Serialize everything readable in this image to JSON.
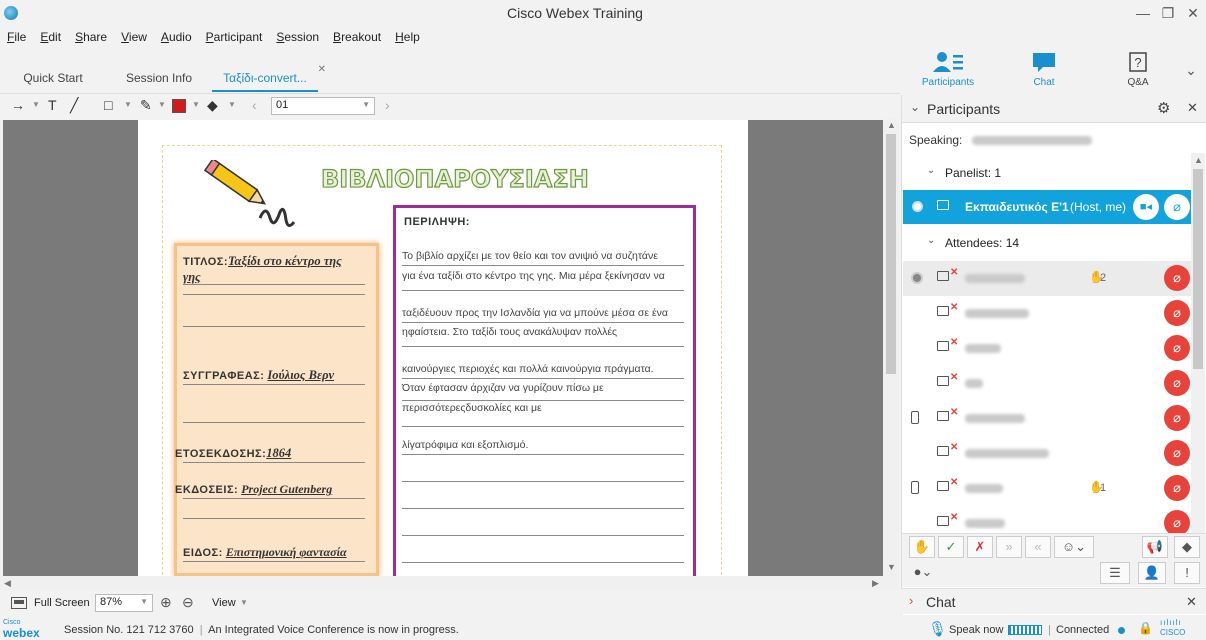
{
  "window": {
    "title": "Cisco Webex Training"
  },
  "menu": [
    "File",
    "Edit",
    "Share",
    "View",
    "Audio",
    "Participant",
    "Session",
    "Breakout",
    "Help"
  ],
  "tabs": [
    {
      "label": "Quick Start",
      "active": false
    },
    {
      "label": "Session Info",
      "active": false
    },
    {
      "label": "Ταξίδι-convert...",
      "active": true
    }
  ],
  "panel_buttons": {
    "participants": "Participants",
    "chat": "Chat",
    "qa": "Q&A"
  },
  "toolbar": {
    "page": "01"
  },
  "document": {
    "title": "ΒΙΒΛΙΟΠΑΡΟΥΣΙΑΣΗ",
    "fields": {
      "title_label": "ΤΙΤΛΟΣ:",
      "title_value": "Ταξίδι στο κέντρο της",
      "title_value2": "γης",
      "author_label": "ΣΥΓΓΡΑΦΕΑΣ:",
      "author_value": "Ιούλιος Βερν",
      "year_label": "ΕΤΟΣΕΚΔΟΣΗΣ:",
      "year_value": "1864",
      "publisher_label": "ΕΚΔΟΣΕΙΣ:",
      "publisher_value": "Project Gutenberg",
      "genre_label": "ΕΙΔΟΣ:",
      "genre_value": "Επιστημονική φαντασία"
    },
    "summary_heading": "ΠΕΡΙΛΗΨΗ:",
    "summary_lines": [
      "Το βιβλίο αρχίζει με τον θείο και τον ανιψιό να συζητάνε",
      "για ένα ταξίδι στο κέντρο της γης. Μια μέρα ξεκίνησαν να",
      "ταξιδέυουν προς την Ισλανδία για να μπούνε μέσα σε ένα",
      "ηφαίστεια. Στο ταξίδι τους ανακάλυψαν πολλές",
      "καινούργιες περιοχές και πολλά καινούργια πράγματα.",
      "Όταν έφτασαν άρχιζαν να γυρίζουν πίσω με",
      "περισσότερεςδυσκολίες και με",
      "λίγατρόφιμα και εξοπλισμό."
    ]
  },
  "zoombar": {
    "fullscreen": "Full Screen",
    "zoom": "87%",
    "view": "View"
  },
  "status": {
    "session": "Session No. 121 712 3760",
    "separator": "|",
    "message": "An Integrated Voice Conference is now in progress.",
    "logo_small": "Cisco",
    "logo_word": "webex",
    "speak_now": "Speak now",
    "connected": "Connected",
    "cisco": "CISCO"
  },
  "participants": {
    "header": "Participants",
    "speaking_label": "Speaking:",
    "panelist_group": "Panelist: 1",
    "host_name": "Εκπαιδευτικός Ε'1",
    "host_suffix": "(Host, me)",
    "attendees_group": "Attendees: 14",
    "attendees": [
      {
        "hand": "2"
      },
      {
        "hand": ""
      },
      {
        "hand": ""
      },
      {
        "hand": ""
      },
      {
        "hand": ""
      },
      {
        "hand": ""
      },
      {
        "hand": "1"
      },
      {
        "hand": ""
      }
    ]
  },
  "chat_panel": {
    "title": "Chat"
  },
  "colors": {
    "accent": "#1a8fd0",
    "host_row": "#13a3dc",
    "mute": "#e8433a",
    "summary_border": "#9b2d9b",
    "title_green": "#6d9a3c"
  }
}
